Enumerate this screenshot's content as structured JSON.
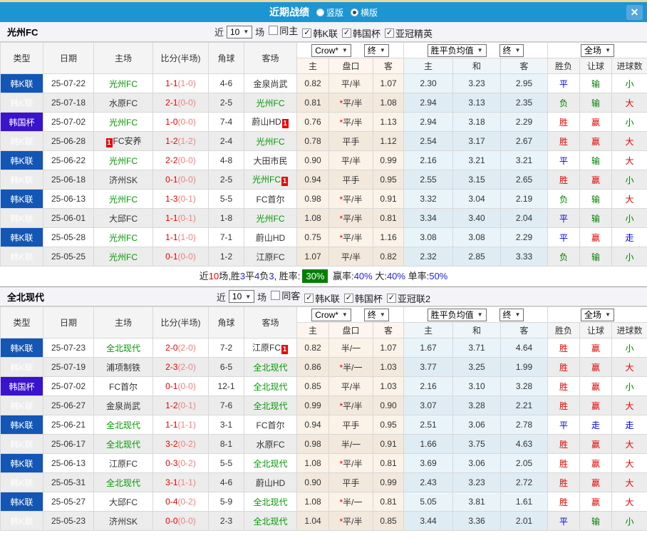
{
  "window": {
    "title": "近期战绩",
    "layout_options": [
      {
        "label": "竖版",
        "selected": false
      },
      {
        "label": "横版",
        "selected": true
      }
    ],
    "close": "✕"
  },
  "filter_bar": {
    "prefix": "近",
    "matches_select": "10",
    "suffix": "场"
  },
  "table_header": {
    "cols": [
      "类型",
      "日期",
      "主场",
      "比分(半场)",
      "角球",
      "客场"
    ],
    "sub": [
      "主",
      "盘口",
      "客",
      "主",
      "和",
      "客",
      "胜负",
      "让球",
      "进球数"
    ],
    "odds_source_select": "Crow*",
    "odds_final_select": "终",
    "avg_select": "胜平负均值",
    "avg_final_select": "终",
    "scope_select": "全场"
  },
  "colors": {
    "accent_blue": "#1d95d3",
    "league_blue": "#1356b5",
    "cup_purple": "#3a13cd",
    "team_green": "#009900",
    "win_red": "#e60000",
    "draw_blue": "#0000cc",
    "loss_green": "#008000",
    "summary_badge_green": "#008000"
  },
  "sections": [
    {
      "team": "光州FC",
      "filters": [
        {
          "label": "同主",
          "checked": false
        },
        {
          "label": "韩K联",
          "checked": true
        },
        {
          "label": "韩国杯",
          "checked": true
        },
        {
          "label": "亚冠精英",
          "checked": true
        }
      ],
      "rows": [
        {
          "type": "韩K联",
          "cup": false,
          "date": "25-07-22",
          "home": "光州FC",
          "home_team": true,
          "home_badge": "",
          "home_badge_pos": "",
          "score": "1-1",
          "half": "(1-0)",
          "corner": "4-6",
          "away": "金泉尚武",
          "away_team": false,
          "away_badge": "",
          "odds_home": "0.82",
          "handicap": "平/半",
          "handicap_star": false,
          "odds_away": "1.07",
          "avg_home": "2.30",
          "avg_draw": "3.23",
          "avg_away": "2.95",
          "result": "平",
          "handicap_result": "输",
          "goals_result": "小"
        },
        {
          "type": "韩K联",
          "cup": false,
          "date": "25-07-18",
          "home": "水原FC",
          "home_team": false,
          "home_badge": "",
          "home_badge_pos": "",
          "score": "2-1",
          "half": "(0-0)",
          "corner": "2-5",
          "away": "光州FC",
          "away_team": true,
          "away_badge": "",
          "odds_home": "0.81",
          "handicap": "平/半",
          "handicap_star": true,
          "odds_away": "1.08",
          "avg_home": "2.94",
          "avg_draw": "3.13",
          "avg_away": "2.35",
          "result": "负",
          "handicap_result": "输",
          "goals_result": "大"
        },
        {
          "type": "韩国杯",
          "cup": true,
          "date": "25-07-02",
          "home": "光州FC",
          "home_team": true,
          "home_badge": "",
          "home_badge_pos": "",
          "score": "1-0",
          "half": "(0-0)",
          "corner": "7-4",
          "away": "蔚山HD",
          "away_team": false,
          "away_badge": "1",
          "odds_home": "0.76",
          "handicap": "平/半",
          "handicap_star": true,
          "odds_away": "1.13",
          "avg_home": "2.94",
          "avg_draw": "3.18",
          "avg_away": "2.29",
          "result": "胜",
          "handicap_result": "赢",
          "goals_result": "小"
        },
        {
          "type": "韩K联",
          "cup": false,
          "date": "25-06-28",
          "home": "FC安养",
          "home_team": false,
          "home_badge": "1",
          "home_badge_pos": "pre",
          "score": "1-2",
          "half": "(1-2)",
          "corner": "2-4",
          "away": "光州FC",
          "away_team": true,
          "away_badge": "",
          "odds_home": "0.78",
          "handicap": "平手",
          "handicap_star": false,
          "odds_away": "1.12",
          "avg_home": "2.54",
          "avg_draw": "3.17",
          "avg_away": "2.67",
          "result": "胜",
          "handicap_result": "赢",
          "goals_result": "大"
        },
        {
          "type": "韩K联",
          "cup": false,
          "date": "25-06-22",
          "home": "光州FC",
          "home_team": true,
          "home_badge": "",
          "home_badge_pos": "",
          "score": "2-2",
          "half": "(0-0)",
          "corner": "4-8",
          "away": "大田市民",
          "away_team": false,
          "away_badge": "",
          "odds_home": "0.90",
          "handicap": "平/半",
          "handicap_star": false,
          "odds_away": "0.99",
          "avg_home": "2.16",
          "avg_draw": "3.21",
          "avg_away": "3.21",
          "result": "平",
          "handicap_result": "输",
          "goals_result": "大"
        },
        {
          "type": "韩K联",
          "cup": false,
          "date": "25-06-18",
          "home": "济州SK",
          "home_team": false,
          "home_badge": "",
          "home_badge_pos": "",
          "score": "0-1",
          "half": "(0-0)",
          "corner": "2-5",
          "away": "光州FC",
          "away_team": true,
          "away_badge": "1",
          "odds_home": "0.94",
          "handicap": "平手",
          "handicap_star": false,
          "odds_away": "0.95",
          "avg_home": "2.55",
          "avg_draw": "3.15",
          "avg_away": "2.65",
          "result": "胜",
          "handicap_result": "赢",
          "goals_result": "小"
        },
        {
          "type": "韩K联",
          "cup": false,
          "date": "25-06-13",
          "home": "光州FC",
          "home_team": true,
          "home_badge": "",
          "home_badge_pos": "",
          "score": "1-3",
          "half": "(0-1)",
          "corner": "5-5",
          "away": "FC首尔",
          "away_team": false,
          "away_badge": "",
          "odds_home": "0.98",
          "handicap": "平/半",
          "handicap_star": true,
          "odds_away": "0.91",
          "avg_home": "3.32",
          "avg_draw": "3.04",
          "avg_away": "2.19",
          "result": "负",
          "handicap_result": "输",
          "goals_result": "大"
        },
        {
          "type": "韩K联",
          "cup": false,
          "date": "25-06-01",
          "home": "大邱FC",
          "home_team": false,
          "home_badge": "",
          "home_badge_pos": "",
          "score": "1-1",
          "half": "(0-1)",
          "corner": "1-8",
          "away": "光州FC",
          "away_team": true,
          "away_badge": "",
          "odds_home": "1.08",
          "handicap": "平/半",
          "handicap_star": true,
          "odds_away": "0.81",
          "avg_home": "3.34",
          "avg_draw": "3.40",
          "avg_away": "2.04",
          "result": "平",
          "handicap_result": "输",
          "goals_result": "小"
        },
        {
          "type": "韩K联",
          "cup": false,
          "date": "25-05-28",
          "home": "光州FC",
          "home_team": true,
          "home_badge": "",
          "home_badge_pos": "",
          "score": "1-1",
          "half": "(1-0)",
          "corner": "7-1",
          "away": "蔚山HD",
          "away_team": false,
          "away_badge": "",
          "odds_home": "0.75",
          "handicap": "平/半",
          "handicap_star": true,
          "odds_away": "1.16",
          "avg_home": "3.08",
          "avg_draw": "3.08",
          "avg_away": "2.29",
          "result": "平",
          "handicap_result": "赢",
          "goals_result": "走"
        },
        {
          "type": "韩K联",
          "cup": false,
          "date": "25-05-25",
          "home": "光州FC",
          "home_team": true,
          "home_badge": "",
          "home_badge_pos": "",
          "score": "0-1",
          "half": "(0-0)",
          "corner": "1-2",
          "away": "江原FC",
          "away_team": false,
          "away_badge": "",
          "odds_home": "1.07",
          "handicap": "平/半",
          "handicap_star": false,
          "odds_away": "0.82",
          "avg_home": "2.32",
          "avg_draw": "2.85",
          "avg_away": "3.33",
          "result": "负",
          "handicap_result": "输",
          "goals_result": "小"
        }
      ],
      "summary": {
        "parts": [
          {
            "text": "近",
            "color": "black"
          },
          {
            "text": "10",
            "color": "red"
          },
          {
            "text": "场,胜",
            "color": "black"
          },
          {
            "text": "3",
            "color": "blue"
          },
          {
            "text": "平",
            "color": "black"
          },
          {
            "text": "4",
            "color": "blue"
          },
          {
            "text": "负",
            "color": "black"
          },
          {
            "text": "3",
            "color": "blue"
          },
          {
            "text": ", 胜率:",
            "color": "black"
          },
          {
            "text": "30%",
            "color": "white",
            "badge": true
          },
          {
            "text": " 赢率:",
            "color": "black"
          },
          {
            "text": "40%",
            "color": "blue"
          },
          {
            "text": " 大:",
            "color": "black"
          },
          {
            "text": "40%",
            "color": "blue"
          },
          {
            "text": " 单率:",
            "color": "black"
          },
          {
            "text": "50%",
            "color": "blue"
          }
        ]
      }
    },
    {
      "team": "全北现代",
      "filters": [
        {
          "label": "同客",
          "checked": false
        },
        {
          "label": "韩K联",
          "checked": true
        },
        {
          "label": "韩国杯",
          "checked": true
        },
        {
          "label": "亚冠联2",
          "checked": true
        }
      ],
      "rows": [
        {
          "type": "韩K联",
          "cup": false,
          "date": "25-07-23",
          "home": "全北现代",
          "home_team": true,
          "home_badge": "",
          "home_badge_pos": "",
          "score": "2-0",
          "half": "(2-0)",
          "corner": "7-2",
          "away": "江原FC",
          "away_team": false,
          "away_badge": "1",
          "odds_home": "0.82",
          "handicap": "半/一",
          "handicap_star": false,
          "odds_away": "1.07",
          "avg_home": "1.67",
          "avg_draw": "3.71",
          "avg_away": "4.64",
          "result": "胜",
          "handicap_result": "赢",
          "goals_result": "小"
        },
        {
          "type": "韩K联",
          "cup": false,
          "date": "25-07-19",
          "home": "浦项制铁",
          "home_team": false,
          "home_badge": "",
          "home_badge_pos": "",
          "score": "2-3",
          "half": "(2-0)",
          "corner": "6-5",
          "away": "全北现代",
          "away_team": true,
          "away_badge": "",
          "odds_home": "0.86",
          "handicap": "半/一",
          "handicap_star": true,
          "odds_away": "1.03",
          "avg_home": "3.77",
          "avg_draw": "3.25",
          "avg_away": "1.99",
          "result": "胜",
          "handicap_result": "赢",
          "goals_result": "大"
        },
        {
          "type": "韩国杯",
          "cup": true,
          "date": "25-07-02",
          "home": "FC首尔",
          "home_team": false,
          "home_badge": "",
          "home_badge_pos": "",
          "score": "0-1",
          "half": "(0-0)",
          "corner": "12-1",
          "away": "全北现代",
          "away_team": true,
          "away_badge": "",
          "odds_home": "0.85",
          "handicap": "平/半",
          "handicap_star": false,
          "odds_away": "1.03",
          "avg_home": "2.16",
          "avg_draw": "3.10",
          "avg_away": "3.28",
          "result": "胜",
          "handicap_result": "赢",
          "goals_result": "小"
        },
        {
          "type": "韩K联",
          "cup": false,
          "date": "25-06-27",
          "home": "金泉尚武",
          "home_team": false,
          "home_badge": "",
          "home_badge_pos": "",
          "score": "1-2",
          "half": "(0-1)",
          "corner": "7-6",
          "away": "全北现代",
          "away_team": true,
          "away_badge": "",
          "odds_home": "0.99",
          "handicap": "平/半",
          "handicap_star": true,
          "odds_away": "0.90",
          "avg_home": "3.07",
          "avg_draw": "3.28",
          "avg_away": "2.21",
          "result": "胜",
          "handicap_result": "赢",
          "goals_result": "大"
        },
        {
          "type": "韩K联",
          "cup": false,
          "date": "25-06-21",
          "home": "全北现代",
          "home_team": true,
          "home_badge": "",
          "home_badge_pos": "",
          "score": "1-1",
          "half": "(1-1)",
          "corner": "3-1",
          "away": "FC首尔",
          "away_team": false,
          "away_badge": "",
          "odds_home": "0.94",
          "handicap": "平手",
          "handicap_star": false,
          "odds_away": "0.95",
          "avg_home": "2.51",
          "avg_draw": "3.06",
          "avg_away": "2.78",
          "result": "平",
          "handicap_result": "走",
          "goals_result": "走"
        },
        {
          "type": "韩K联",
          "cup": false,
          "date": "25-06-17",
          "home": "全北现代",
          "home_team": true,
          "home_badge": "",
          "home_badge_pos": "",
          "score": "3-2",
          "half": "(0-2)",
          "corner": "8-1",
          "away": "水原FC",
          "away_team": false,
          "away_badge": "",
          "odds_home": "0.98",
          "handicap": "半/一",
          "handicap_star": false,
          "odds_away": "0.91",
          "avg_home": "1.66",
          "avg_draw": "3.75",
          "avg_away": "4.63",
          "result": "胜",
          "handicap_result": "赢",
          "goals_result": "大"
        },
        {
          "type": "韩K联",
          "cup": false,
          "date": "25-06-13",
          "home": "江原FC",
          "home_team": false,
          "home_badge": "",
          "home_badge_pos": "",
          "score": "0-3",
          "half": "(0-2)",
          "corner": "5-5",
          "away": "全北现代",
          "away_team": true,
          "away_badge": "",
          "odds_home": "1.08",
          "handicap": "平/半",
          "handicap_star": true,
          "odds_away": "0.81",
          "avg_home": "3.69",
          "avg_draw": "3.06",
          "avg_away": "2.05",
          "result": "胜",
          "handicap_result": "赢",
          "goals_result": "大"
        },
        {
          "type": "韩K联",
          "cup": false,
          "date": "25-05-31",
          "home": "全北现代",
          "home_team": true,
          "home_badge": "",
          "home_badge_pos": "",
          "score": "3-1",
          "half": "(1-1)",
          "corner": "4-6",
          "away": "蔚山HD",
          "away_team": false,
          "away_badge": "",
          "odds_home": "0.90",
          "handicap": "平手",
          "handicap_star": false,
          "odds_away": "0.99",
          "avg_home": "2.43",
          "avg_draw": "3.23",
          "avg_away": "2.72",
          "result": "胜",
          "handicap_result": "赢",
          "goals_result": "大"
        },
        {
          "type": "韩K联",
          "cup": false,
          "date": "25-05-27",
          "home": "大邱FC",
          "home_team": false,
          "home_badge": "",
          "home_badge_pos": "",
          "score": "0-4",
          "half": "(0-2)",
          "corner": "5-9",
          "away": "全北现代",
          "away_team": true,
          "away_badge": "",
          "odds_home": "1.08",
          "handicap": "半/一",
          "handicap_star": true,
          "odds_away": "0.81",
          "avg_home": "5.05",
          "avg_draw": "3.81",
          "avg_away": "1.61",
          "result": "胜",
          "handicap_result": "赢",
          "goals_result": "大"
        },
        {
          "type": "韩K联",
          "cup": false,
          "date": "25-05-23",
          "home": "济州SK",
          "home_team": false,
          "home_badge": "",
          "home_badge_pos": "",
          "score": "0-0",
          "half": "(0-0)",
          "corner": "2-3",
          "away": "全北现代",
          "away_team": true,
          "away_badge": "",
          "odds_home": "1.04",
          "handicap": "平/半",
          "handicap_star": true,
          "odds_away": "0.85",
          "avg_home": "3.44",
          "avg_draw": "3.36",
          "avg_away": "2.01",
          "result": "平",
          "handicap_result": "输",
          "goals_result": "小"
        }
      ],
      "summary": null
    }
  ]
}
